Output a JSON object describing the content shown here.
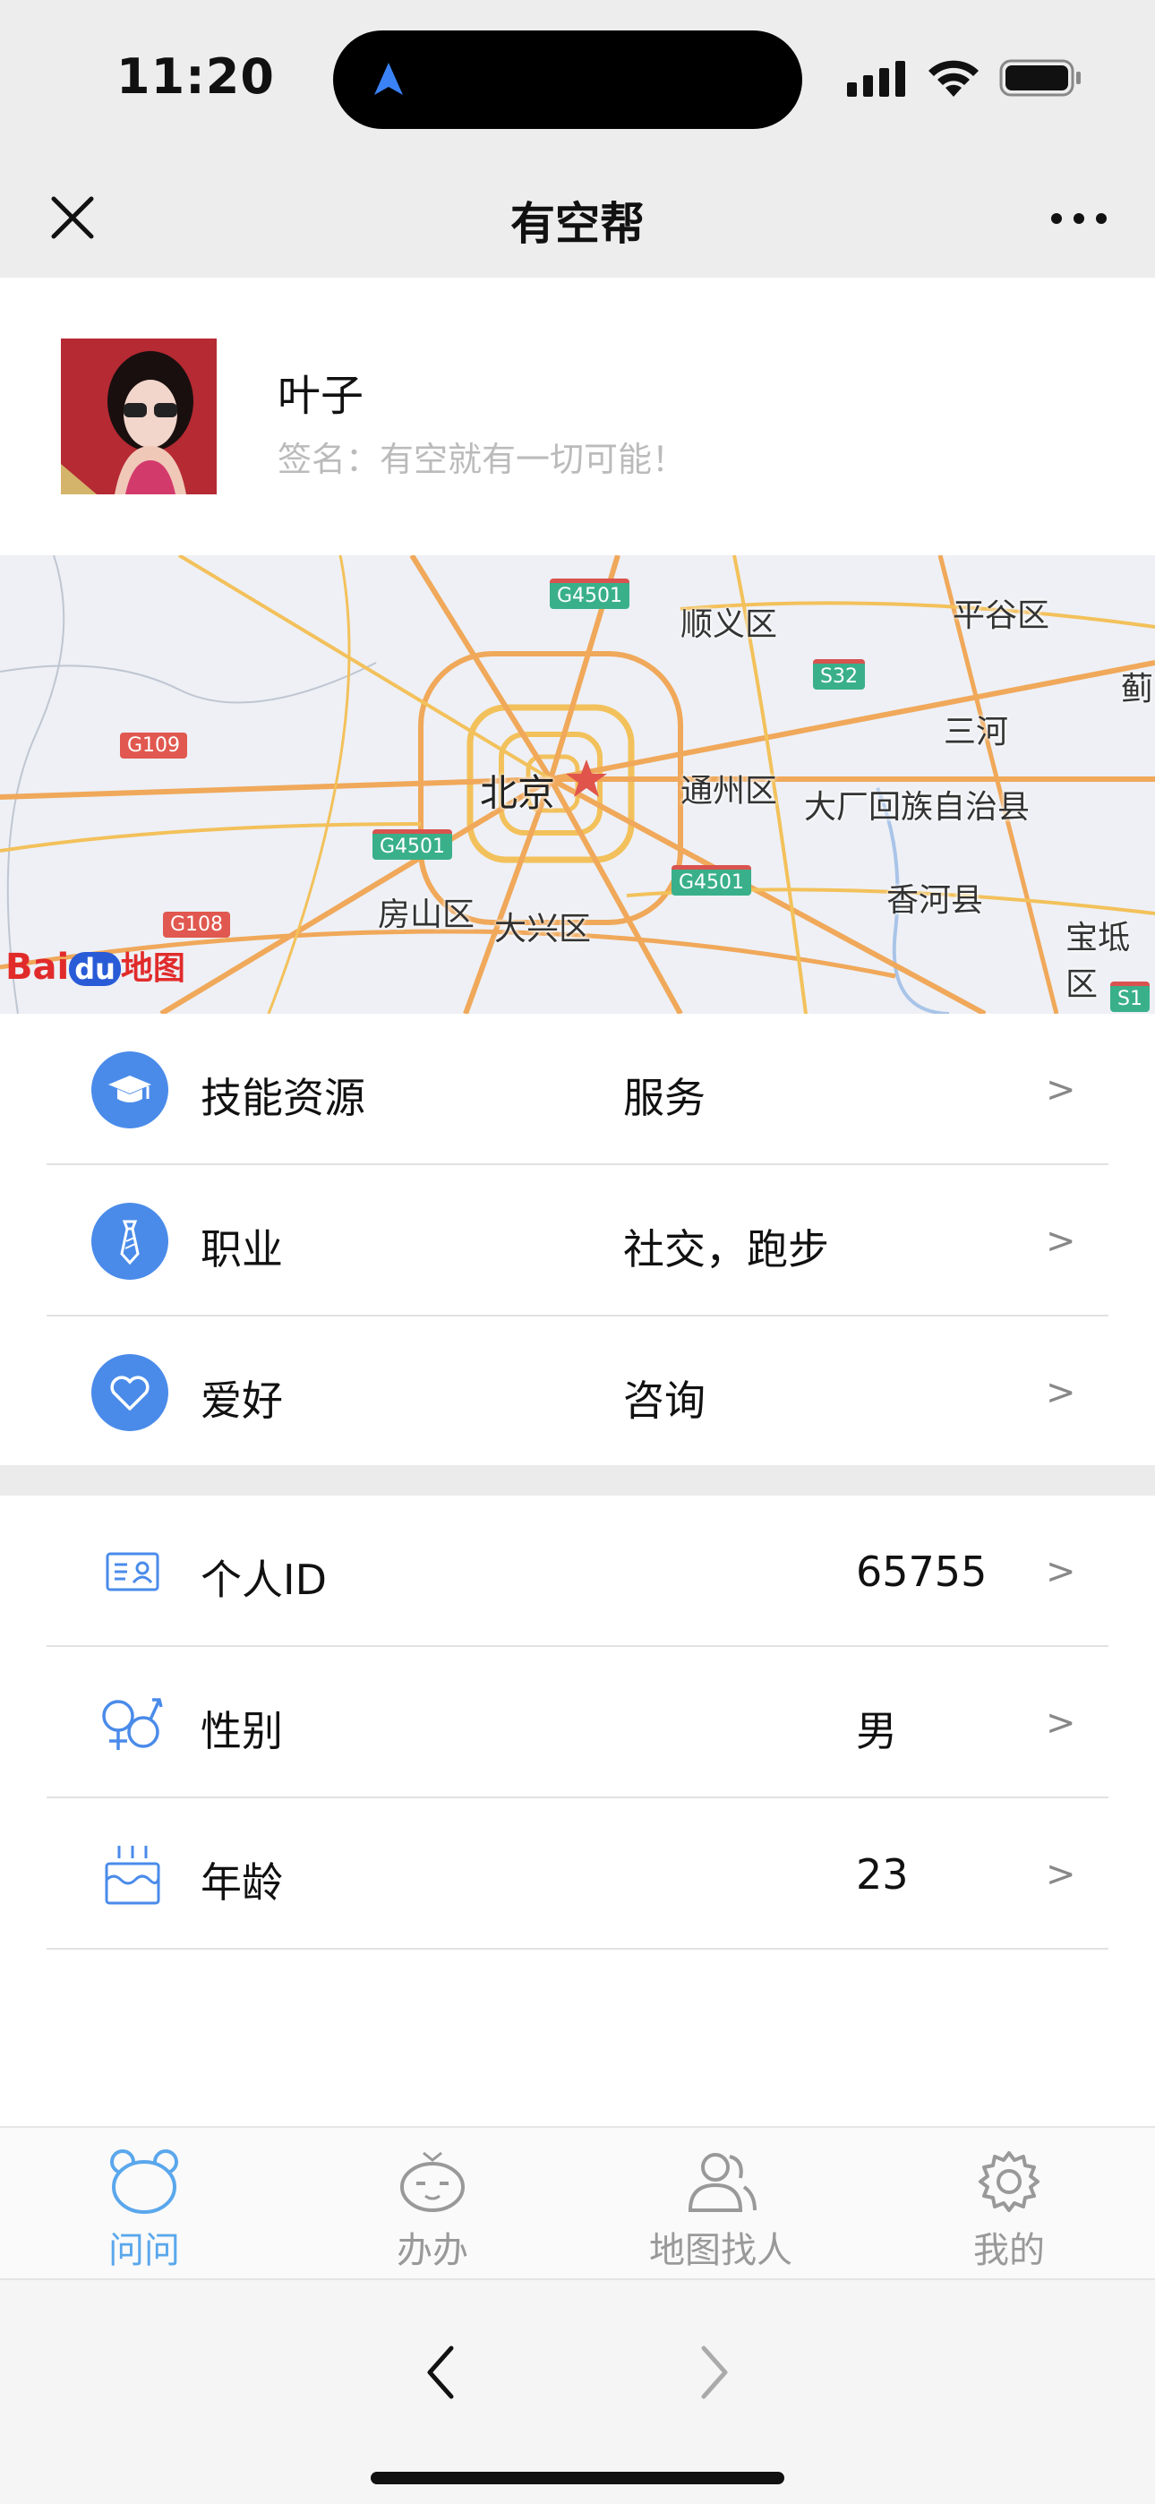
{
  "status_bar": {
    "time": "11:20"
  },
  "nav": {
    "title": "有空帮"
  },
  "profile": {
    "name": "叶子",
    "signature": "签名：有空就有一切可能！"
  },
  "map": {
    "labels": {
      "shunyi": "顺义区",
      "pinggu": "平谷区",
      "sanhe": "三河",
      "beijing": "北京",
      "tongzhou": "通州区",
      "dachang": "大厂回族自治县",
      "xianghe": "香河县",
      "fangshan": "房山区",
      "daxing": "大兴区",
      "baodi": "宝坻区",
      "ji": "蓟"
    },
    "roads": {
      "g4501_a": "G4501",
      "g4501_b": "G4501",
      "g4501_c": "G4501",
      "s32": "S32",
      "g109": "G109",
      "g108": "G108",
      "s1": "S1"
    },
    "logo": {
      "bai": "Bai",
      "du": "du",
      "ditu": "地图"
    }
  },
  "skills": {
    "rows": [
      {
        "label": "技能资源",
        "value": "服务",
        "chevron": ">"
      },
      {
        "label": "职业",
        "value": "社交，跑步",
        "chevron": ">"
      },
      {
        "label": "爱好",
        "value": "咨询",
        "chevron": ">"
      }
    ]
  },
  "info": {
    "rows": [
      {
        "label": "个人ID",
        "value": "65755",
        "chevron": ">"
      },
      {
        "label": "性别",
        "value": "男",
        "chevron": ">"
      },
      {
        "label": "年龄",
        "value": "23",
        "chevron": ">"
      }
    ]
  },
  "tabs": [
    {
      "label": "问问",
      "active": true
    },
    {
      "label": "办办",
      "active": false
    },
    {
      "label": "地图找人",
      "active": false
    },
    {
      "label": "我的",
      "active": false
    }
  ],
  "colors": {
    "accent": "#4a8bea",
    "tab_active": "#5aa7ec",
    "tab_inactive": "#999999"
  }
}
